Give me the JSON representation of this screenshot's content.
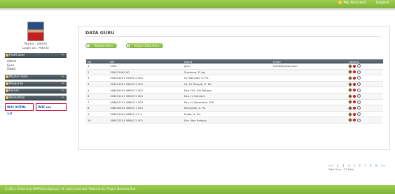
{
  "topbar": {
    "account": "My Account",
    "logout": "Logout"
  },
  "sidebar": {
    "welcome_line1": "Nama : admin",
    "welcome_line2": "Login as : Admin",
    "menus": [
      {
        "label": "Profil User",
        "sub": [
          "Admin",
          "Guru",
          "Siswa"
        ]
      },
      {
        "label": "Master Data",
        "sub": []
      },
      {
        "label": "Pelajaran",
        "sub": []
      },
      {
        "label": "Forum",
        "sub": []
      },
      {
        "label": "Konsultasi",
        "sub": []
      }
    ],
    "badge1": "W3C XHTML 1.0",
    "badge2": "W3C css"
  },
  "main": {
    "title": "DATA GURU",
    "button1_num": "1",
    "button1": "Tambah Guru",
    "button2_num": "2",
    "button2": "Import Data Guru"
  },
  "table": {
    "headers": [
      "No",
      "NIP",
      "Nama",
      "Email",
      "Options"
    ],
    "rows": [
      [
        "1",
        "1234",
        "guru",
        "thedt@yahoo.com"
      ],
      [
        "2",
        "195071405 00",
        "Sumarno, S. Ag",
        ""
      ],
      [
        "3",
        "195501221 97903 2 001",
        "Hj. Samyati, S. Pd.",
        ""
      ],
      [
        "4",
        "195401021 98003 2 001",
        "Hj. Sri Mulyati, S. Pd.",
        ""
      ],
      [
        "5",
        "196405291 98503 2 002",
        "Dra. H.R. Siti Rahayu",
        ""
      ],
      [
        "6",
        "196201121 98503 2 001",
        "Dra. H. Rumiani",
        ""
      ],
      [
        "7",
        "196601191 98803 1 003",
        "Drs. H. Darmanto, S.IP",
        ""
      ],
      [
        "8",
        "196305251 98503 1 022",
        "Maryanto, S. Pd.",
        ""
      ],
      [
        "9",
        "196512051 98803 1 0 2",
        "Sujito, S. Pd.",
        ""
      ],
      [
        "10",
        "196512101 98403 2 001",
        "Dra. Atin Rahayu",
        ""
      ]
    ]
  },
  "pager": {
    "pages": [
      "<<",
      "2",
      "3",
      "4",
      "5",
      "6",
      "7",
      "8",
      "9",
      ">>"
    ],
    "total": "Total Guru : 97 Data"
  },
  "footer": {
    "text": "© 2011. E-learning SMAN Karanganyar. All rights reserved. Powered by: Aryani, Nurumia Sari."
  }
}
